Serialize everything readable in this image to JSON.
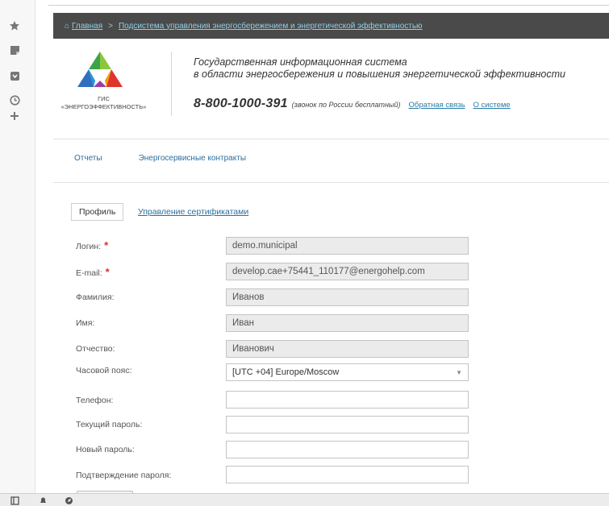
{
  "browser": {
    "left_icons": [
      "star-icon",
      "note-icon",
      "save-icon",
      "clock-icon",
      "plus-icon"
    ],
    "bottom_icons": [
      "sidebar-icon",
      "bell-icon",
      "compass-icon"
    ]
  },
  "breadcrumb": {
    "home": "Главная",
    "separator": ">",
    "current": "Подсистема управления энергосбережением и энергетической эффективностью"
  },
  "header": {
    "logo_caption_line1": "ГИС",
    "logo_caption_line2": "«ЭНЕРГОЭФФЕКТИВНОСТЬ»",
    "title_line1": "Государственная информационная система",
    "title_line2": "в области энергосбережения и повышения энергетической эффективности",
    "phone": "8-800-1000-391",
    "phone_note": "(звонок по России бесплатный)",
    "feedback_link": "Обратная связь",
    "about_link": "О системе",
    "colors": {
      "logo_green": "#3aa548",
      "logo_blue": "#2f6fc0",
      "logo_red": "#e0342c"
    }
  },
  "nav": {
    "items": [
      "Отчеты",
      "Энергосервисные контракты"
    ]
  },
  "tabs": {
    "profile": "Профиль",
    "certificates": "Управление сертификатами"
  },
  "form": {
    "required_mark": "*",
    "login_label": "Логин:",
    "login_value": "demo.municipal",
    "email_label": "E-mail:",
    "email_value": "develop.cae+75441_110177@energohelp.com",
    "lastname_label": "Фамилия:",
    "lastname_value": "Иванов",
    "firstname_label": "Имя:",
    "firstname_value": "Иван",
    "patronymic_label": "Отчество:",
    "patronymic_value": "Иванович",
    "timezone_label": "Часовой пояс:",
    "timezone_value": "[UTC +04] Europe/Moscow",
    "phone_label": "Телефон:",
    "phone_value": "",
    "current_password_label": "Текущий пароль:",
    "new_password_label": "Новый пароль:",
    "confirm_password_label": "Подтверждение пароля:"
  }
}
